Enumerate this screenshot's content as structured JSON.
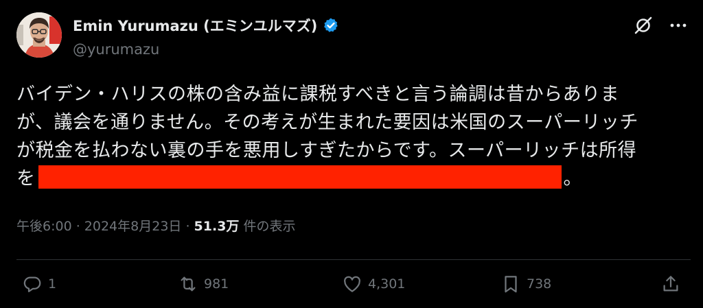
{
  "author": {
    "display_name": "Emin Yurumazu (エミンユルマズ)",
    "handle": "@yurumazu"
  },
  "post": {
    "lines": [
      "バイデン・ハリスの株の含み益に課税すべきと言う論調は昔からありま",
      "が、議会を通りません。その考えが生まれた要因は米国のスーパーリッチ",
      "が税金を払わない裏の手を悪用しすぎたからです。スーパーリッチは所得"
    ],
    "last_line_prefix": "を",
    "last_line_suffix": "。",
    "timestamp": "午後6:00 · 2024年8月23日 · ",
    "views_count": "51.3万",
    "views_label": " 件の表示"
  },
  "actions": {
    "replies": "1",
    "reposts": "981",
    "likes": "4,301",
    "bookmarks": "738"
  },
  "colors": {
    "background": "#000000",
    "text": "#e7e9ea",
    "secondary": "#71767b",
    "verified": "#1d9bf0",
    "redaction": "#ff2200"
  }
}
